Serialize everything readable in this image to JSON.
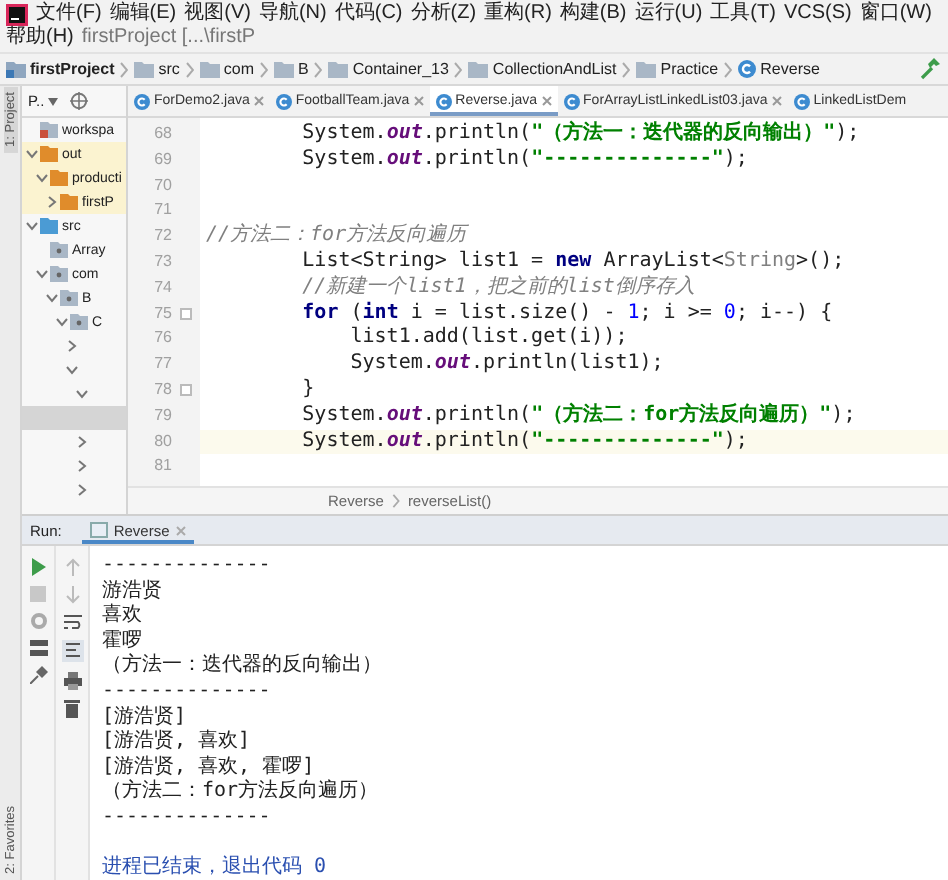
{
  "menu_bar": {
    "items": [
      "文件(F)",
      "编辑(E)",
      "视图(V)",
      "导航(N)",
      "代码(C)",
      "分析(Z)",
      "重构(R)",
      "构建(B)",
      "运行(U)",
      "工具(T)",
      "VCS(S)",
      "窗口(W)",
      "帮助(H)"
    ],
    "title": "firstProject [...\\firstP"
  },
  "breadcrumb": [
    {
      "label": "firstProject",
      "kind": "module"
    },
    {
      "label": "src",
      "kind": "folder"
    },
    {
      "label": "com",
      "kind": "folder"
    },
    {
      "label": "B",
      "kind": "folder"
    },
    {
      "label": "Container_13",
      "kind": "folder"
    },
    {
      "label": "CollectionAndList",
      "kind": "folder"
    },
    {
      "label": "Practice",
      "kind": "folder"
    },
    {
      "label": "Reverse",
      "kind": "class"
    }
  ],
  "tool_strip": {
    "top": "1: Project",
    "bottom": "2: Favorites"
  },
  "project": {
    "title": "P..",
    "tree": [
      {
        "label": "workspa",
        "kind": "module",
        "selected": false
      },
      {
        "label": "out",
        "kind": "excluded",
        "expanded": true,
        "selected": false,
        "children": [
          {
            "label": "producti",
            "kind": "excluded",
            "expanded": true,
            "selected": false,
            "children": [
              {
                "label": "firstP",
                "kind": "excluded",
                "expanded": false,
                "selected": false
              }
            ]
          }
        ]
      },
      {
        "label": "src",
        "kind": "source",
        "expanded": true,
        "selected": false,
        "children": [
          {
            "label": "Array",
            "kind": "package",
            "selected": false
          },
          {
            "label": "com",
            "kind": "package",
            "expanded": true,
            "selected": false,
            "children": [
              {
                "label": "B",
                "kind": "package",
                "expanded": true,
                "selected": false,
                "children": [
                  {
                    "label": "C",
                    "kind": "package",
                    "expanded": true,
                    "selected": false,
                    "children": [
                      {
                        "expanded": false,
                        "selected": false
                      },
                      {
                        "expanded": true,
                        "selected": false,
                        "children": [
                          {
                            "expanded": true,
                            "selected": false
                          },
                          {
                            "selected": true
                          },
                          {
                            "expanded": false,
                            "selected": false
                          },
                          {
                            "expanded": false,
                            "selected": false
                          },
                          {
                            "expanded": false,
                            "selected": false
                          }
                        ]
                      }
                    ]
                  }
                ]
              }
            ]
          }
        ]
      }
    ]
  },
  "tabs": [
    {
      "label": "ForDemo2.java",
      "selected": false,
      "closable": true
    },
    {
      "label": "FootballTeam.java",
      "selected": false,
      "closable": true
    },
    {
      "label": "Reverse.java",
      "selected": true,
      "closable": true
    },
    {
      "label": "ForArrayListLinkedList03.java",
      "selected": false,
      "closable": true
    },
    {
      "label": "LinkedListDem",
      "selected": false,
      "closable": false
    }
  ],
  "editor": {
    "lines": [
      {
        "number": "68",
        "current": false,
        "fold": false,
        "tokens": [
          {
            "kind": "plain",
            "text": "        System."
          },
          {
            "kind": "field",
            "text": "out"
          },
          {
            "kind": "plain",
            "text": ".println("
          },
          {
            "kind": "string",
            "text": "\"（方法一：迭代器的反向输出）\""
          },
          {
            "kind": "plain",
            "text": ");"
          }
        ]
      },
      {
        "number": "69",
        "current": false,
        "fold": false,
        "tokens": [
          {
            "kind": "plain",
            "text": "        System."
          },
          {
            "kind": "field",
            "text": "out"
          },
          {
            "kind": "plain",
            "text": ".println("
          },
          {
            "kind": "string",
            "text": "\"--------------\""
          },
          {
            "kind": "plain",
            "text": ");"
          }
        ]
      },
      {
        "number": "70",
        "current": false,
        "fold": false
      },
      {
        "number": "71",
        "current": false,
        "fold": false
      },
      {
        "number": "72",
        "current": false,
        "fold": false,
        "tokens": [
          {
            "kind": "comment",
            "text": "//方法二：for方法反向遍历"
          }
        ]
      },
      {
        "number": "73",
        "current": false,
        "fold": false,
        "tokens": [
          {
            "kind": "plain",
            "text": "        List<String> list1 = "
          },
          {
            "kind": "keyword",
            "text": "new"
          },
          {
            "kind": "plain",
            "text": " ArrayList<"
          },
          {
            "kind": "generic",
            "text": "String"
          },
          {
            "kind": "plain",
            "text": ">();"
          }
        ]
      },
      {
        "number": "74",
        "current": false,
        "fold": false,
        "tokens": [
          {
            "kind": "comment",
            "text": "        //新建一个list1，把之前的list倒序存入"
          }
        ]
      },
      {
        "number": "75",
        "current": false,
        "fold": true,
        "tokens": [
          {
            "kind": "keyword",
            "text": "        for"
          },
          {
            "kind": "plain",
            "text": " ("
          },
          {
            "kind": "keyword",
            "text": "int"
          },
          {
            "kind": "plain",
            "text": " i = list.size() - "
          },
          {
            "kind": "number",
            "text": "1"
          },
          {
            "kind": "plain",
            "text": "; i >= "
          },
          {
            "kind": "number",
            "text": "0"
          },
          {
            "kind": "plain",
            "text": "; i--) {"
          }
        ]
      },
      {
        "number": "76",
        "current": false,
        "fold": false,
        "tokens": [
          {
            "kind": "plain",
            "text": "            list1.add(list.get(i));"
          }
        ]
      },
      {
        "number": "77",
        "current": false,
        "fold": false,
        "tokens": [
          {
            "kind": "plain",
            "text": "            System."
          },
          {
            "kind": "field",
            "text": "out"
          },
          {
            "kind": "plain",
            "text": ".println(list1);"
          }
        ]
      },
      {
        "number": "78",
        "current": false,
        "fold": true,
        "tokens": [
          {
            "kind": "plain",
            "text": "        }"
          }
        ]
      },
      {
        "number": "79",
        "current": false,
        "fold": false,
        "tokens": [
          {
            "kind": "plain",
            "text": "        System."
          },
          {
            "kind": "field",
            "text": "out"
          },
          {
            "kind": "plain",
            "text": ".println("
          },
          {
            "kind": "string",
            "text": "\"（方法二：for方法反向遍历）\""
          },
          {
            "kind": "plain",
            "text": ");"
          }
        ]
      },
      {
        "number": "80",
        "current": true,
        "fold": false,
        "tokens": [
          {
            "kind": "plain",
            "text": "        System."
          },
          {
            "kind": "field",
            "text": "out"
          },
          {
            "kind": "plain",
            "text": ".println("
          },
          {
            "kind": "string",
            "text": "\"--------------\""
          },
          {
            "kind": "plain",
            "text": ");"
          }
        ]
      },
      {
        "number": "81",
        "current": false,
        "fold": false
      }
    ],
    "footer": [
      "Reverse",
      "reverseList()"
    ]
  },
  "run": {
    "label": "Run:",
    "tabs": [
      {
        "label": "Reverse",
        "selected": true
      }
    ],
    "console": [
      {
        "kind": "output",
        "text": "--------------"
      },
      {
        "kind": "output",
        "text": "游浩贤"
      },
      {
        "kind": "output",
        "text": "喜欢"
      },
      {
        "kind": "output",
        "text": "霍啰"
      },
      {
        "kind": "output",
        "text": "（方法一：迭代器的反向输出）"
      },
      {
        "kind": "output",
        "text": "--------------"
      },
      {
        "kind": "output",
        "text": "[游浩贤]"
      },
      {
        "kind": "output",
        "text": "[游浩贤, 喜欢]"
      },
      {
        "kind": "output",
        "text": "[游浩贤, 喜欢, 霍啰]"
      },
      {
        "kind": "output",
        "text": "（方法二：for方法反向遍历）"
      },
      {
        "kind": "output",
        "text": "--------------"
      },
      {
        "kind": "exit",
        "text": "进程已结束，退出代码 0"
      }
    ]
  }
}
